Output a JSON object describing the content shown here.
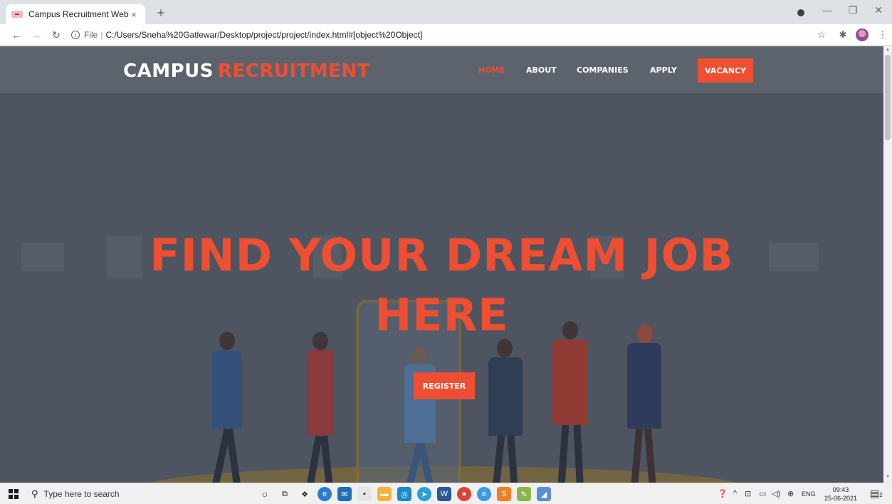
{
  "browser": {
    "tab_title": "Campus Recruitment Website",
    "tab_close": "×",
    "new_tab": "+",
    "url_scheme": "File",
    "url_separator": "|",
    "url": "C:/Users/Sneha%20Gatlewar/Desktop/project/project/index.html#[object%20Object]",
    "icons": [
      "back-arrow-icon",
      "forward-arrow-icon",
      "reload-icon",
      "info-icon",
      "star-icon",
      "extensions-icon",
      "menu-icon"
    ]
  },
  "site": {
    "logo_primary": "CAMPUS",
    "logo_accent": "RECRUITMENT",
    "nav": [
      {
        "label": "HOME",
        "active": true
      },
      {
        "label": "ABOUT",
        "active": false
      },
      {
        "label": "COMPANIES",
        "active": false
      },
      {
        "label": "APPLY",
        "active": false
      }
    ],
    "cta_label": "VACANCY",
    "hero_line1": "FIND YOUR DREAM JOB",
    "hero_line2": "HERE",
    "register_label": "REGISTER",
    "accent_color": "#ee4f33"
  },
  "taskbar": {
    "search_placeholder": "Type here to search",
    "tray_lang": "ENG",
    "time": "09:43",
    "date": "25-06-2021",
    "notification_count": "2"
  }
}
